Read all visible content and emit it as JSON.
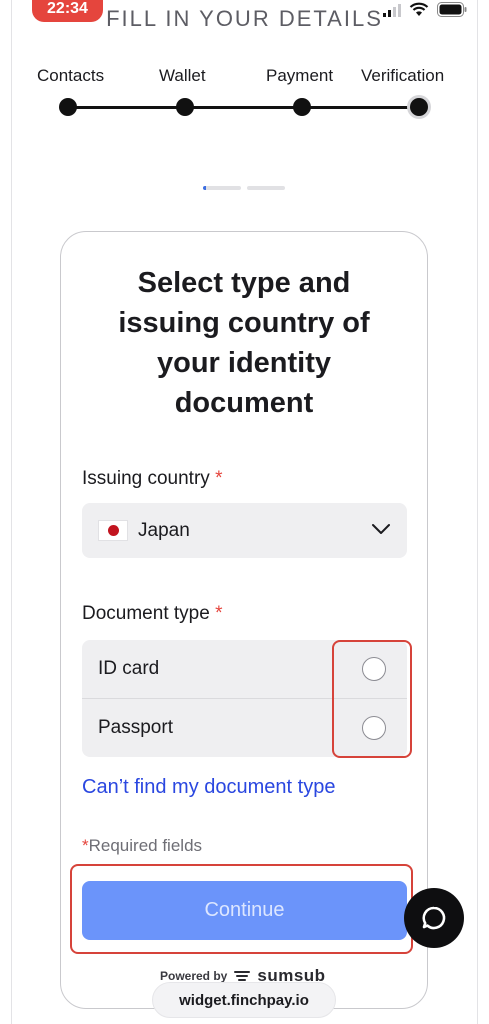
{
  "status_bar": {
    "time": "22:34"
  },
  "header": {
    "title": "FILL IN YOUR DETAILS"
  },
  "steps": [
    {
      "label": "Contacts"
    },
    {
      "label": "Wallet"
    },
    {
      "label": "Payment"
    },
    {
      "label": "Verification"
    }
  ],
  "card": {
    "title": "Select type and issuing country of your identity document",
    "issuing_country": {
      "label": "Issuing country",
      "required_mark": "*",
      "value": "Japan",
      "flag_icon": "japan-flag-icon"
    },
    "document_type": {
      "label": "Document type",
      "required_mark": "*",
      "options": [
        {
          "label": "ID card"
        },
        {
          "label": "Passport"
        }
      ]
    },
    "cant_find_link": "Can’t find my document type",
    "required_note": {
      "mark": "*",
      "text": "Required fields"
    },
    "continue_label": "Continue",
    "powered_by": "Powered by",
    "brand": "sumsub"
  },
  "browser": {
    "url": "widget.finchpay.io"
  },
  "colors": {
    "accent": "#6b94fa",
    "link": "#2a47e0",
    "required": "#e5453d",
    "highlight": "#d6433a"
  }
}
